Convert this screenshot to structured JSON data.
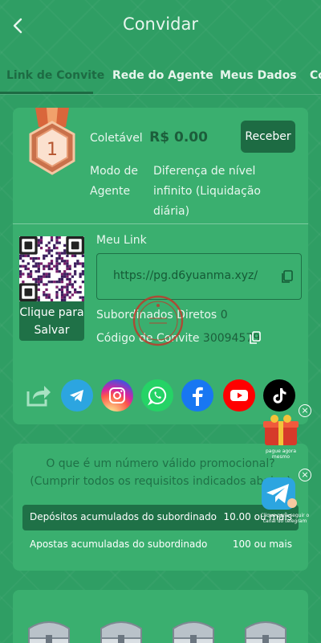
{
  "header": {
    "title": "Convidar",
    "back_icon": "chevron-left-icon"
  },
  "tabs": [
    {
      "label": "Link de Convite",
      "active": true
    },
    {
      "label": "Rede do Agente",
      "active": false
    },
    {
      "label": "Meus Dados",
      "active": false
    },
    {
      "label": "Co",
      "active": false
    }
  ],
  "rank": {
    "level": "1"
  },
  "collect": {
    "label": "Coletável",
    "amount": "R$ 0.00",
    "button": "Receber"
  },
  "agent_mode": {
    "label": "Modo de Agente",
    "value": "Diferença de nível infinito (Liquidação diária)"
  },
  "qr": {
    "save_label": "Clique para Salvar"
  },
  "link": {
    "label": "Meu Link",
    "url": "https://pg.d6yuanma.xyz/"
  },
  "subordinates": {
    "label": "Subordinados Diretos",
    "value": "0"
  },
  "code": {
    "label": "Código de Convite",
    "value": "30094579"
  },
  "social": [
    "share",
    "telegram",
    "instagram",
    "whatsapp",
    "facebook",
    "youtube",
    "tiktok"
  ],
  "criteria": {
    "question": "O que é um número válido promocional? (Cumprir todos os requisitos indicados abaixo)",
    "rows": [
      {
        "label": "Depósitos acumulados do subordinado",
        "value": "10.00 ou mais"
      },
      {
        "label": "Apostas acumuladas do subordinado",
        "value": "100 ou mais"
      }
    ]
  },
  "floating": {
    "promo_label": "pague agora mesmo",
    "telegram_label": "Clique para seguir o canal do telegram"
  },
  "colors": {
    "bg": "#2f9e64",
    "card": "#3aaf6f",
    "accent_dark": "#1d6b43"
  }
}
